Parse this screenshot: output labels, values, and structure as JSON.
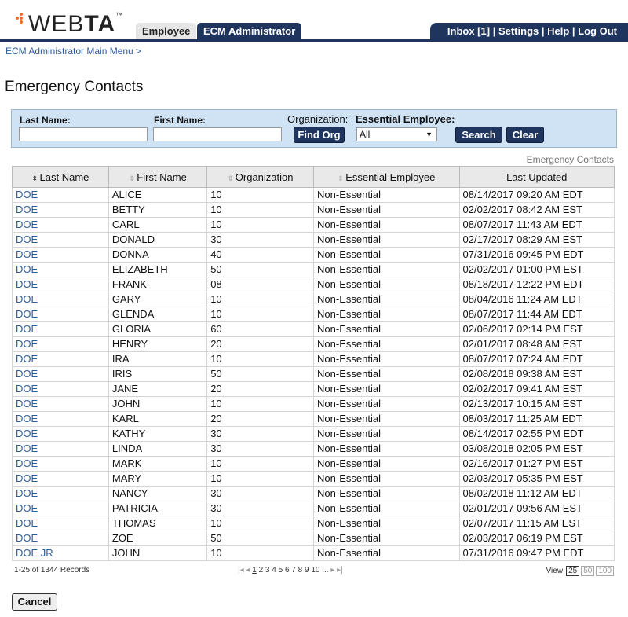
{
  "header": {
    "logo": "WEBTA",
    "tabs": [
      "Employee",
      "ECM Administrator"
    ],
    "nav": [
      "Inbox [1]",
      "Settings",
      "Help",
      "Log Out"
    ]
  },
  "breadcrumb": "ECM Administrator Main Menu >",
  "page_title": "Emergency Contacts",
  "filter": {
    "last_name_label": "Last Name:",
    "first_name_label": "First Name:",
    "org_label": "Organization:",
    "find_org": "Find Org",
    "essential_label": "Essential Employee:",
    "essential_value": "All",
    "search": "Search",
    "clear": "Clear",
    "last_name_value": "",
    "first_name_value": ""
  },
  "table": {
    "caption": "Emergency Contacts",
    "columns": [
      "Last Name",
      "First Name",
      "Organization",
      "Essential Employee",
      "Last Updated"
    ],
    "rows": [
      [
        "DOE",
        "ALICE",
        "10",
        "Non-Essential",
        "08/14/2017 09:20 AM EDT"
      ],
      [
        "DOE",
        "BETTY",
        "10",
        "Non-Essential",
        "02/02/2017 08:42 AM EST"
      ],
      [
        "DOE",
        "CARL",
        "10",
        "Non-Essential",
        "08/07/2017 11:43 AM EDT"
      ],
      [
        "DOE",
        "DONALD",
        "30",
        "Non-Essential",
        "02/17/2017 08:29 AM EST"
      ],
      [
        "DOE",
        "DONNA",
        "40",
        "Non-Essential",
        "07/31/2016 09:45 PM EDT"
      ],
      [
        "DOE",
        "ELIZABETH",
        "50",
        "Non-Essential",
        "02/02/2017 01:00 PM EST"
      ],
      [
        "DOE",
        "FRANK",
        "08",
        "Non-Essential",
        "08/18/2017 12:22 PM EDT"
      ],
      [
        "DOE",
        "GARY",
        "10",
        "Non-Essential",
        "08/04/2016 11:24 AM EDT"
      ],
      [
        "DOE",
        "GLENDA",
        "10",
        "Non-Essential",
        "08/07/2017 11:44 AM EDT"
      ],
      [
        "DOE",
        "GLORIA",
        "60",
        "Non-Essential",
        "02/06/2017 02:14 PM EST"
      ],
      [
        "DOE",
        "HENRY",
        "20",
        "Non-Essential",
        "02/01/2017 08:48 AM EST"
      ],
      [
        "DOE",
        "IRA",
        "10",
        "Non-Essential",
        "08/07/2017 07:24 AM EDT"
      ],
      [
        "DOE",
        "IRIS",
        "50",
        "Non-Essential",
        "02/08/2018 09:38 AM EST"
      ],
      [
        "DOE",
        "JANE",
        "20",
        "Non-Essential",
        "02/02/2017 09:41 AM EST"
      ],
      [
        "DOE",
        "JOHN",
        "10",
        "Non-Essential",
        "02/13/2017 10:15 AM EST"
      ],
      [
        "DOE",
        "KARL",
        "20",
        "Non-Essential",
        "08/03/2017 11:25 AM EDT"
      ],
      [
        "DOE",
        "KATHY",
        "30",
        "Non-Essential",
        "08/14/2017 02:55 PM EDT"
      ],
      [
        "DOE",
        "LINDA",
        "30",
        "Non-Essential",
        "03/08/2018 02:05 PM EST"
      ],
      [
        "DOE",
        "MARK",
        "10",
        "Non-Essential",
        "02/16/2017 01:27 PM EST"
      ],
      [
        "DOE",
        "MARY",
        "10",
        "Non-Essential",
        "02/03/2017 05:35 PM EST"
      ],
      [
        "DOE",
        "NANCY",
        "30",
        "Non-Essential",
        "08/02/2018 11:12 AM EDT"
      ],
      [
        "DOE",
        "PATRICIA",
        "30",
        "Non-Essential",
        "02/01/2017 09:56 AM EST"
      ],
      [
        "DOE",
        "THOMAS",
        "10",
        "Non-Essential",
        "02/07/2017 11:15 AM EST"
      ],
      [
        "DOE",
        "ZOE",
        "50",
        "Non-Essential",
        "02/03/2017 06:19 PM EST"
      ],
      [
        "DOE JR",
        "JOHN",
        "10",
        "Non-Essential",
        "07/31/2016 09:47 PM EDT"
      ]
    ]
  },
  "footer": {
    "records": "1-25 of 1344 Records",
    "pages": [
      "1",
      "2",
      "3",
      "4",
      "5",
      "6",
      "7",
      "8",
      "9",
      "10",
      "..."
    ],
    "view_label": "View",
    "view_options": [
      "25",
      "50",
      "100"
    ],
    "view_selected": "25"
  },
  "cancel": "Cancel"
}
